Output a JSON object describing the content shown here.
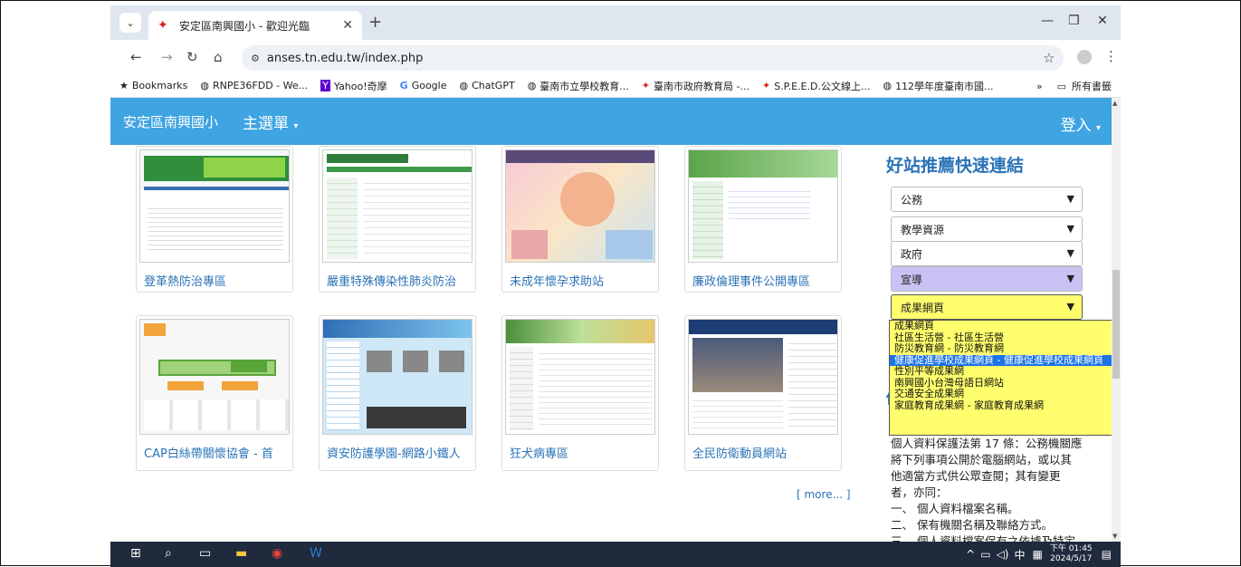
{
  "browser": {
    "tab_title": "安定區南興國小 - 歡迎光臨",
    "new_tab": "+",
    "url": "anses.tn.edu.tw/index.php",
    "bookmarks": [
      {
        "label": "Bookmarks",
        "icon": "star-icon"
      },
      {
        "label": "RNPE36FDD - We...",
        "icon": "globe-icon"
      },
      {
        "label": "Yahoo!奇摩",
        "icon": "yahoo-icon"
      },
      {
        "label": "Google",
        "icon": "google-icon"
      },
      {
        "label": "ChatGPT",
        "icon": "globe-icon"
      },
      {
        "label": "臺南市立學校教育...",
        "icon": "globe-icon"
      },
      {
        "label": "臺南市政府教育局 -...",
        "icon": "school-icon"
      },
      {
        "label": "S.P.E.E.D.公文線上...",
        "icon": "school-icon"
      },
      {
        "label": "112學年度臺南市國...",
        "icon": "globe-icon"
      }
    ],
    "all_bookmarks": "所有書籤",
    "overflow": "»"
  },
  "navbar": {
    "brand": "安定區南興國小",
    "menu": "主選單",
    "login": "登入"
  },
  "links": [
    {
      "label": "登革熱防治專區"
    },
    {
      "label": "嚴重特殊傳染性肺炎防治"
    },
    {
      "label": "未成年懷孕求助站"
    },
    {
      "label": "廉政倫理事件公開專區"
    },
    {
      "label": "CAP白絲帶關懷協會 - 首"
    },
    {
      "label": "資安防護學園-網路小鐵人"
    },
    {
      "label": "狂犬病專區"
    },
    {
      "label": "全民防衛動員網站"
    }
  ],
  "more": "[ more... ]",
  "sidebar": {
    "title": "好站推薦快速連結",
    "selects": [
      {
        "value": "公務",
        "bg": "#ffffff"
      },
      {
        "value": "教學資源",
        "bg": "#ffffff"
      },
      {
        "value": "政府",
        "bg": "#ffffff"
      },
      {
        "value": "宣導",
        "bg": "#c9c3f5"
      },
      {
        "value": "成果網頁",
        "bg": "#ffff6e"
      }
    ],
    "dropdown_options": [
      "成果網頁",
      "社區生活營 - 社區生活營",
      "防災教育網 - 防災教育網",
      "健康促進學校成果網頁 - 健康促進學校成果網頁",
      "性別平等成果網",
      "南興國小台灣母語日網站",
      "交通安全成果網",
      "家庭教育成果網 - 家庭教育成果網"
    ],
    "active_option_index": 3,
    "partial_heading": "個",
    "privacy_lines": [
      "個人資料保護法第 17 條：公務機關應",
      "將下列事項公開於電腦網站，或以其",
      "他適當方式供公眾查閱；其有變更",
      "者，亦同：",
      "一、 個人資料檔案名稱。",
      "二、 保有機關名稱及聯絡方式。",
      "三、 個人資料檔案保有之依據及特定"
    ]
  },
  "taskbar": {
    "ime": "中",
    "time": "下午 01:45",
    "date": "2024/5/17"
  }
}
